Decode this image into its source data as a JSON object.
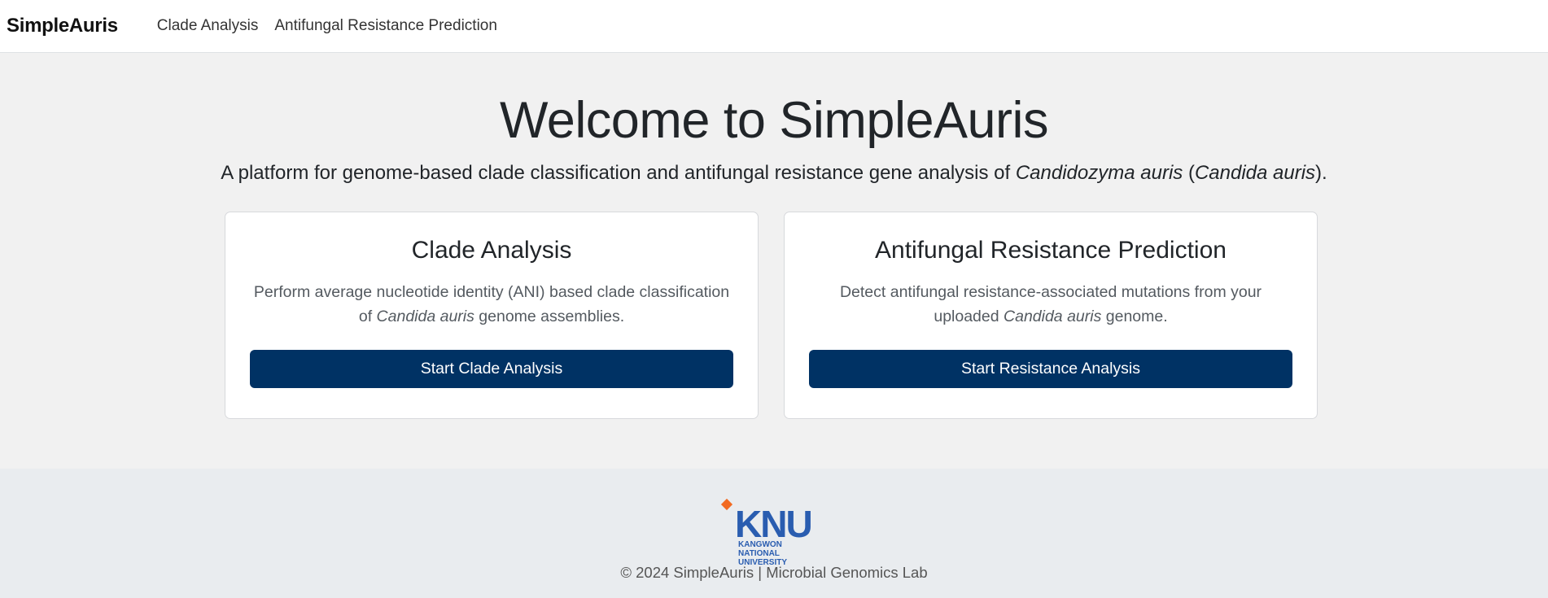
{
  "navbar": {
    "brand": "SimpleAuris",
    "links": [
      "Clade Analysis",
      "Antifungal Resistance Prediction"
    ]
  },
  "hero": {
    "title": "Welcome to SimpleAuris",
    "subtitle_prefix": "A platform for genome-based clade classification and antifungal resistance gene analysis of ",
    "subtitle_species": "Candidozyma auris",
    "subtitle_paren_open": " (",
    "subtitle_synonym": "Candida auris",
    "subtitle_suffix": ")."
  },
  "cards": [
    {
      "title": "Clade Analysis",
      "desc_prefix": "Perform average nucleotide identity (ANI) based clade classification of ",
      "desc_species": "Candida auris",
      "desc_suffix": " genome assemblies.",
      "button": "Start Clade Analysis"
    },
    {
      "title": "Antifungal Resistance Prediction",
      "desc_prefix": "Detect antifungal resistance-associated mutations from your uploaded ",
      "desc_species": "Candida auris",
      "desc_suffix": " genome.",
      "button": "Start Resistance Analysis"
    }
  ],
  "footer": {
    "logo_word": "KNU",
    "logo_line1": "KANGWON NATIONAL",
    "logo_line2": "UNIVERSITY",
    "copyright": "© 2024 SimpleAuris | Microbial Genomics Lab"
  },
  "colors": {
    "primary_button": "#003264",
    "logo_blue": "#2a5db0",
    "logo_orange": "#f26a21"
  }
}
